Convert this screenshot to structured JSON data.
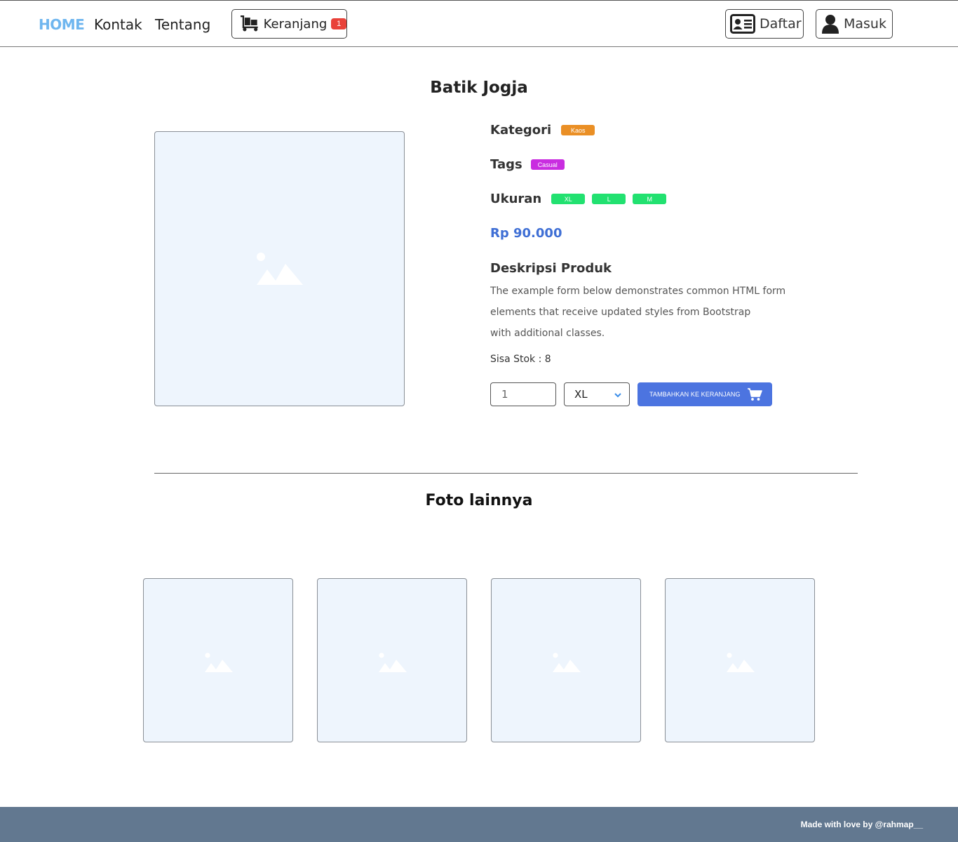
{
  "navbar": {
    "home": "HOME",
    "kontak": "Kontak",
    "tentang": "Tentang",
    "cart_label": "Keranjang",
    "cart_count": "1",
    "register": "Daftar",
    "login": "Masuk"
  },
  "product": {
    "title": "Batik Jogja",
    "category_label": "Kategori",
    "category": "Kaos",
    "tags_label": "Tags",
    "tag": "Casual",
    "sizes_label": "Ukuran",
    "sizes": [
      "XL",
      "L",
      "M"
    ],
    "price": "Rp 90.000",
    "description_title": "Deskripsi Produk",
    "description_lines": [
      "The example form below demonstrates common HTML form",
      "elements that receive updated styles from Bootstrap",
      "with additional classes."
    ],
    "stock_label": "Sisa Stok : ",
    "stock_value": "8",
    "quantity": "1",
    "selected_size": "XL",
    "add_to_cart": "TAMBAHKAN KE KERANJANG"
  },
  "other_photos": {
    "title": "Foto lainnya"
  },
  "footer": {
    "text": "Made with love by @rahmap__"
  },
  "colors": {
    "home_link": "#6fb6ef",
    "cart_badge": "#e9423a",
    "category_pill": "#ea8f25",
    "tag_pill": "#c92de0",
    "size_pill": "#22e170",
    "price": "#3f6fd5",
    "primary_button": "#4c74e0",
    "footer": "#627890"
  },
  "icons": [
    "cart-dolly-icon",
    "id-card-icon",
    "user-icon",
    "image-placeholder-icon",
    "chevron-down-icon",
    "shopping-cart-icon"
  ]
}
